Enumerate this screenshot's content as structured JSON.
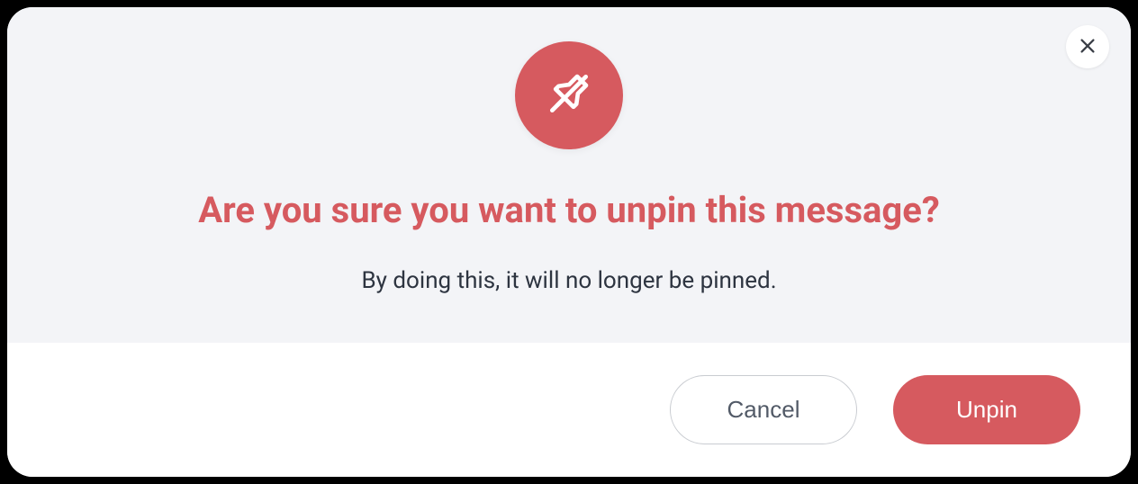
{
  "modal": {
    "title": "Are you sure you want to unpin this message?",
    "description": "By doing this, it will no longer be pinned.",
    "cancel_label": "Cancel",
    "confirm_label": "Unpin",
    "icon_name": "unpin-icon",
    "accent_color": "#d65a5f"
  }
}
